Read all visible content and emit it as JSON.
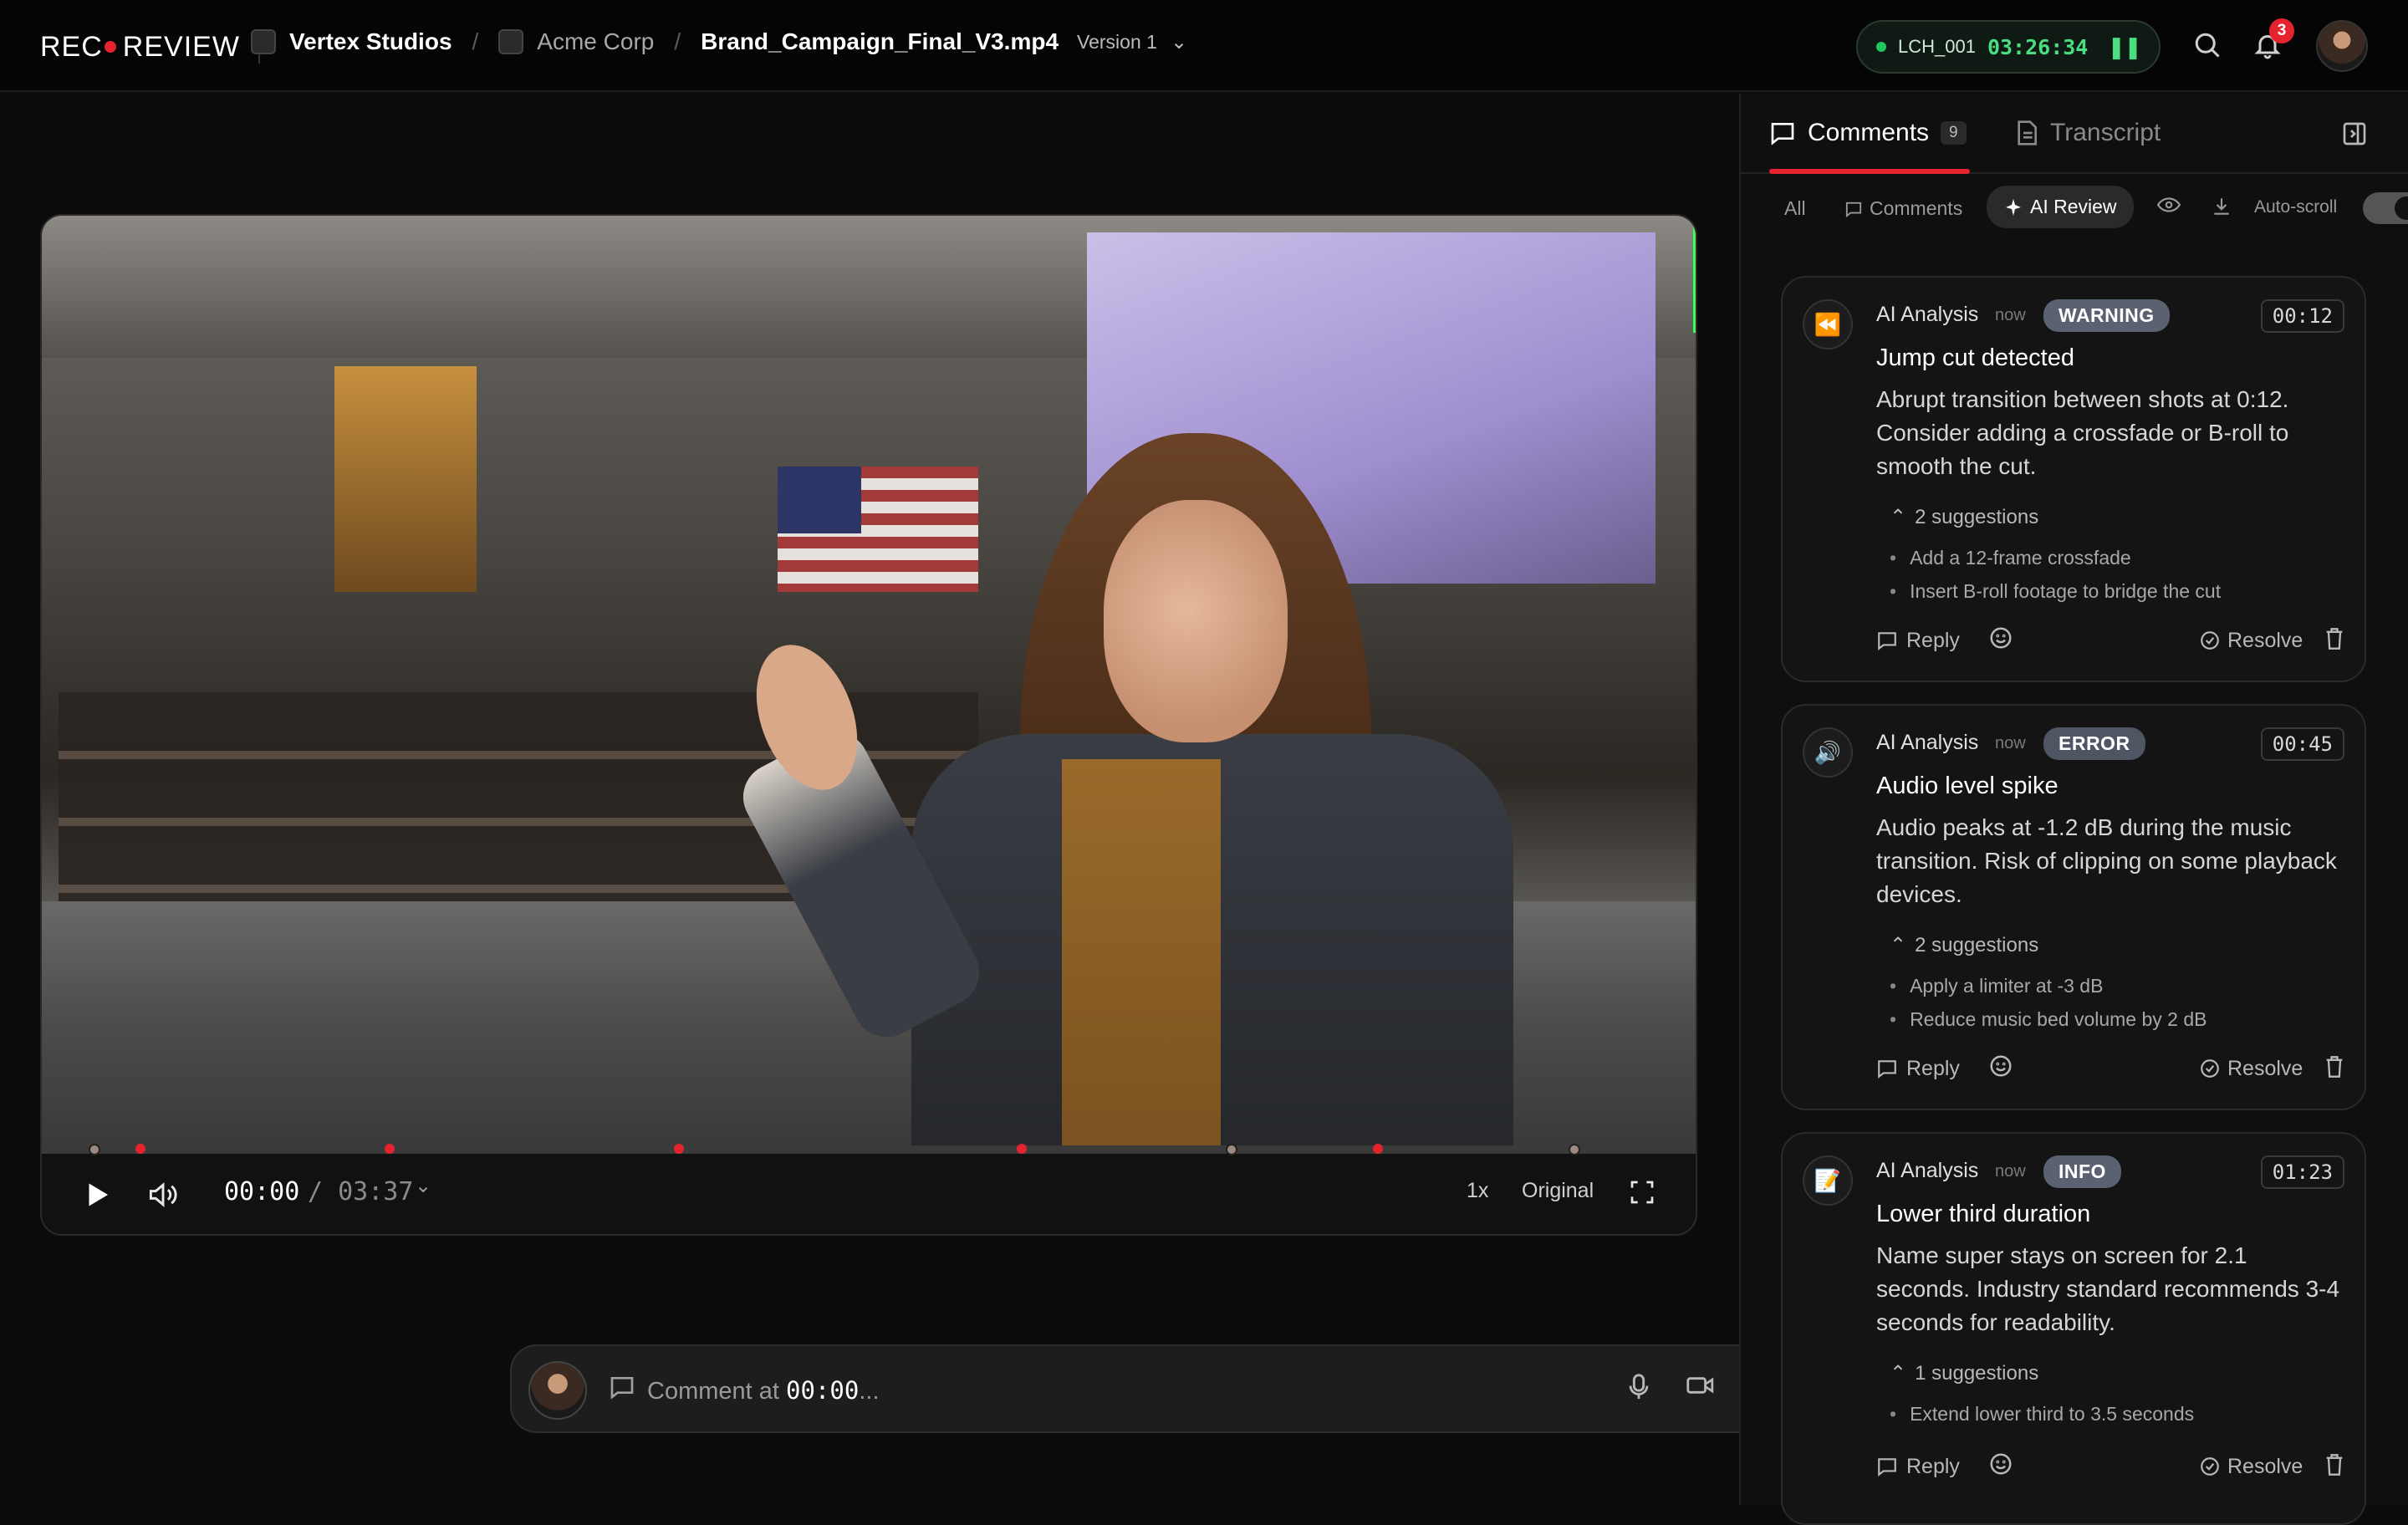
{
  "brand": {
    "left": "REC",
    "right": "REVIEW",
    "accent": "#e5232f"
  },
  "breadcrumb": {
    "workspace": "Vertex Studios",
    "client": "Acme Corp",
    "file": "Brand_Campaign_Final_V3.mp4",
    "version": "Version 1",
    "separator": "/"
  },
  "session": {
    "code": "LCH_001",
    "time": "03:26:34"
  },
  "notifications": {
    "count": "3"
  },
  "player": {
    "current_time": "00:00",
    "total_time": "/ 03:37",
    "speed": "1x",
    "quality": "Original"
  },
  "comment_input": {
    "placeholder_prefix": "Comment at",
    "timestamp": "00:00",
    "placeholder_suffix": "..."
  },
  "panel": {
    "tabs": [
      {
        "label": "Comments",
        "count": "9"
      },
      {
        "label": "Transcript"
      }
    ],
    "filters": {
      "all": "All",
      "comments": "Comments",
      "ai_review": "AI Review",
      "autoscroll": "Auto-scroll"
    }
  },
  "cards": [
    {
      "author": "AI Analysis",
      "when": "now",
      "severity": "WARNING",
      "severity_color": "#5a6170",
      "timestamp": "00:12",
      "title": "Jump cut detected",
      "body": "Abrupt transition between shots at 0:12. Consider adding a crossfade or B-roll to smooth the cut.",
      "suggestions_label": "2 suggestions",
      "suggestions": [
        "Add a 12-frame crossfade",
        "Insert B-roll footage to bridge the cut"
      ],
      "reply": "Reply",
      "resolve": "Resolve"
    },
    {
      "author": "AI Analysis",
      "when": "now",
      "severity": "ERROR",
      "severity_color": "#4f5563",
      "timestamp": "00:45",
      "title": "Audio level spike",
      "body": "Audio peaks at -1.2 dB during the music transition. Risk of clipping on some playback devices.",
      "suggestions_label": "2 suggestions",
      "suggestions": [
        "Apply a limiter at -3 dB",
        "Reduce music bed volume by 2 dB"
      ],
      "reply": "Reply",
      "resolve": "Resolve"
    },
    {
      "author": "AI Analysis",
      "when": "now",
      "severity": "INFO",
      "severity_color": "#5a6170",
      "timestamp": "01:23",
      "title": "Lower third duration",
      "body": "Name super stays on screen for 2.1 seconds. Industry standard recommends 3-4 seconds for readability.",
      "suggestions_label": "1 suggestions",
      "suggestions": [
        "Extend lower third to 3.5 seconds"
      ],
      "reply": "Reply",
      "resolve": "Resolve"
    }
  ]
}
